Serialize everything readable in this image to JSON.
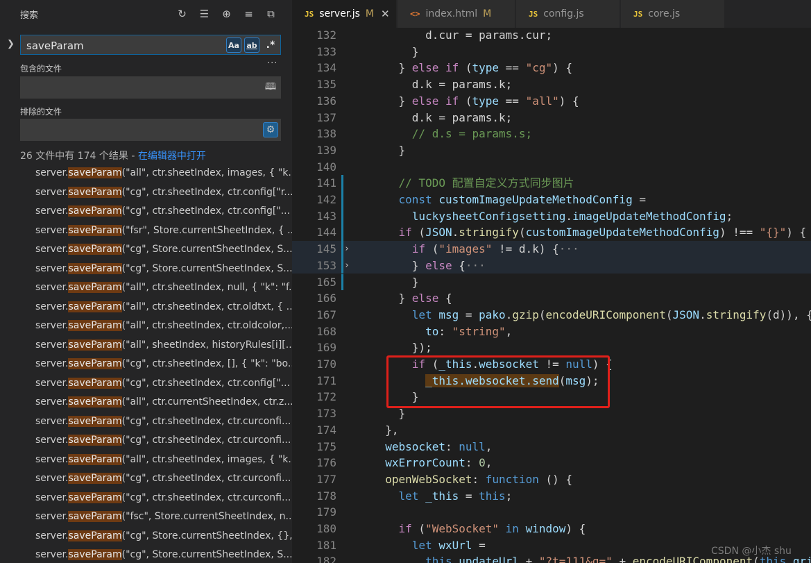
{
  "search_panel": {
    "title": "搜索",
    "toolbar_icons": [
      "refresh-icon",
      "clear-results-icon",
      "new-search-editor-icon",
      "collapse-all-icon",
      "view-as-tree-icon"
    ],
    "query": "saveParam",
    "match_case_label": "Aa",
    "whole_word_label": "ab",
    "regex_label": ".*",
    "more_label": "···",
    "include_label": "包含的文件",
    "include_value": "",
    "exclude_label": "排除的文件",
    "exclude_value": "",
    "summary_text": "26 文件中有 174 个结果 - ",
    "summary_link": "在编辑器中打开",
    "results": [
      {
        "pre": "server.",
        "match": "saveParam",
        "post": "(\"all\", ctr.sheetIndex, images, { \"k..."
      },
      {
        "pre": "server.",
        "match": "saveParam",
        "post": "(\"cg\", ctr.sheetIndex, ctr.config[\"r..."
      },
      {
        "pre": "server.",
        "match": "saveParam",
        "post": "(\"cg\", ctr.sheetIndex, ctr.config[\"..."
      },
      {
        "pre": "server.",
        "match": "saveParam",
        "post": "(\"fsr\", Store.currentSheetIndex, { ..."
      },
      {
        "pre": "server.",
        "match": "saveParam",
        "post": "(\"cg\", Store.currentSheetIndex, S..."
      },
      {
        "pre": "server.",
        "match": "saveParam",
        "post": "(\"cg\", Store.currentSheetIndex, S..."
      },
      {
        "pre": "server.",
        "match": "saveParam",
        "post": "(\"all\", ctr.sheetIndex, null, { \"k\": \"f..."
      },
      {
        "pre": "server.",
        "match": "saveParam",
        "post": "(\"all\", ctr.sheetIndex, ctr.oldtxt, { ..."
      },
      {
        "pre": "server.",
        "match": "saveParam",
        "post": "(\"all\", ctr.sheetIndex, ctr.oldcolor,..."
      },
      {
        "pre": "server.",
        "match": "saveParam",
        "post": "(\"all\", sheetIndex, historyRules[i][..."
      },
      {
        "pre": "server.",
        "match": "saveParam",
        "post": "(\"cg\", ctr.sheetIndex, [], { \"k\": \"bo..."
      },
      {
        "pre": "server.",
        "match": "saveParam",
        "post": "(\"cg\", ctr.sheetIndex, ctr.config[\"..."
      },
      {
        "pre": "server.",
        "match": "saveParam",
        "post": "(\"all\", ctr.currentSheetIndex, ctr.z..."
      },
      {
        "pre": "server.",
        "match": "saveParam",
        "post": "(\"cg\", ctr.sheetIndex, ctr.curconfi..."
      },
      {
        "pre": "server.",
        "match": "saveParam",
        "post": "(\"cg\", ctr.sheetIndex, ctr.curconfi..."
      },
      {
        "pre": "server.",
        "match": "saveParam",
        "post": "(\"all\", ctr.sheetIndex, images, { \"k..."
      },
      {
        "pre": "server.",
        "match": "saveParam",
        "post": "(\"cg\", ctr.sheetIndex, ctr.curconfi..."
      },
      {
        "pre": "server.",
        "match": "saveParam",
        "post": "(\"cg\", ctr.sheetIndex, ctr.curconfi..."
      },
      {
        "pre": "server.",
        "match": "saveParam",
        "post": "(\"fsc\", Store.currentSheetIndex, n..."
      },
      {
        "pre": "server.",
        "match": "saveParam",
        "post": "(\"cg\", Store.currentSheetIndex, {},..."
      },
      {
        "pre": "server.",
        "match": "saveParam",
        "post": "(\"cg\", Store.currentSheetIndex, S..."
      }
    ]
  },
  "tabs": [
    {
      "icon": "JS",
      "label": "server.js",
      "mod": "M",
      "close": "✕",
      "active": true
    },
    {
      "icon": "<>",
      "label": "index.html",
      "mod": "M",
      "close": "",
      "active": false
    },
    {
      "icon": "JS",
      "label": "config.js",
      "mod": "",
      "close": "",
      "active": false
    },
    {
      "icon": "JS",
      "label": "core.js",
      "mod": "",
      "close": "",
      "active": false
    }
  ],
  "editor": {
    "lines": [
      {
        "n": "132",
        "code": [
          [
            "p",
            "        d.cur = params.cur;"
          ]
        ]
      },
      {
        "n": "133",
        "code": [
          [
            "p",
            "      }"
          ]
        ]
      },
      {
        "n": "134",
        "code": [
          [
            "p",
            "    } "
          ],
          [
            "c",
            "else"
          ],
          [
            "p",
            " "
          ],
          [
            "c",
            "if"
          ],
          [
            "p",
            " ("
          ],
          [
            "v",
            "type"
          ],
          [
            "p",
            " == "
          ],
          [
            "s",
            "\"cg\""
          ],
          [
            "p",
            ") {"
          ]
        ]
      },
      {
        "n": "135",
        "code": [
          [
            "p",
            "      d.k = params.k;"
          ]
        ]
      },
      {
        "n": "136",
        "code": [
          [
            "p",
            "    } "
          ],
          [
            "c",
            "else"
          ],
          [
            "p",
            " "
          ],
          [
            "c",
            "if"
          ],
          [
            "p",
            " ("
          ],
          [
            "v",
            "type"
          ],
          [
            "p",
            " == "
          ],
          [
            "s",
            "\"all\""
          ],
          [
            "p",
            ") {"
          ]
        ]
      },
      {
        "n": "137",
        "code": [
          [
            "p",
            "      d.k = params.k;"
          ]
        ]
      },
      {
        "n": "138",
        "code": [
          [
            "cm",
            "      // d.s = params.s;"
          ]
        ]
      },
      {
        "n": "139",
        "code": [
          [
            "p",
            "    }"
          ]
        ]
      },
      {
        "n": "140",
        "code": []
      },
      {
        "n": "141",
        "code": [
          [
            "cm",
            "    // TODO 配置自定义方式同步图片"
          ]
        ]
      },
      {
        "n": "142",
        "code": [
          [
            "k",
            "    const"
          ],
          [
            "p",
            " "
          ],
          [
            "v",
            "customImageUpdateMethodConfig"
          ],
          [
            "p",
            " ="
          ]
        ]
      },
      {
        "n": "143",
        "code": [
          [
            "p",
            "      "
          ],
          [
            "v",
            "luckysheetConfigsetting"
          ],
          [
            "p",
            "."
          ],
          [
            "v",
            "imageUpdateMethodConfig"
          ],
          [
            "p",
            ";"
          ]
        ]
      },
      {
        "n": "144",
        "code": [
          [
            "p",
            "    "
          ],
          [
            "c",
            "if"
          ],
          [
            "p",
            " ("
          ],
          [
            "v",
            "JSON"
          ],
          [
            "p",
            "."
          ],
          [
            "f",
            "stringify"
          ],
          [
            "p",
            "("
          ],
          [
            "v",
            "customImageUpdateMethodConfig"
          ],
          [
            "p",
            ") !== "
          ],
          [
            "s",
            "\"{}\""
          ],
          [
            "p",
            ") {"
          ]
        ]
      },
      {
        "n": "145",
        "fold": "›",
        "folded": true,
        "code": [
          [
            "p",
            "      "
          ],
          [
            "c",
            "if"
          ],
          [
            "p",
            " ("
          ],
          [
            "s",
            "\"images\""
          ],
          [
            "p",
            " != d.k) {"
          ],
          [
            "ellip",
            "···"
          ]
        ]
      },
      {
        "n": "153",
        "fold": "›",
        "folded": true,
        "code": [
          [
            "p",
            "      } "
          ],
          [
            "c",
            "else"
          ],
          [
            "p",
            " {"
          ],
          [
            "ellip",
            "···"
          ]
        ]
      },
      {
        "n": "165",
        "code": [
          [
            "p",
            "      }"
          ]
        ]
      },
      {
        "n": "166",
        "code": [
          [
            "p",
            "    } "
          ],
          [
            "c",
            "else"
          ],
          [
            "p",
            " {"
          ]
        ]
      },
      {
        "n": "167",
        "code": [
          [
            "p",
            "      "
          ],
          [
            "k",
            "let"
          ],
          [
            "p",
            " "
          ],
          [
            "v",
            "msg"
          ],
          [
            "p",
            " = "
          ],
          [
            "v",
            "pako"
          ],
          [
            "p",
            "."
          ],
          [
            "f",
            "gzip"
          ],
          [
            "p",
            "("
          ],
          [
            "f",
            "encodeURIComponent"
          ],
          [
            "p",
            "("
          ],
          [
            "v",
            "JSON"
          ],
          [
            "p",
            "."
          ],
          [
            "f",
            "stringify"
          ],
          [
            "p",
            "(d)), {"
          ]
        ]
      },
      {
        "n": "168",
        "code": [
          [
            "p",
            "        "
          ],
          [
            "v",
            "to"
          ],
          [
            "p",
            ": "
          ],
          [
            "s",
            "\"string\""
          ],
          [
            "p",
            ","
          ]
        ]
      },
      {
        "n": "169",
        "code": [
          [
            "p",
            "      });"
          ]
        ]
      },
      {
        "n": "170",
        "code": [
          [
            "p",
            "      "
          ],
          [
            "c",
            "if"
          ],
          [
            "p",
            " ("
          ],
          [
            "v",
            "_this"
          ],
          [
            "p",
            "."
          ],
          [
            "v",
            "websocket"
          ],
          [
            "p",
            " != "
          ],
          [
            "k",
            "null"
          ],
          [
            "p",
            ") {"
          ]
        ]
      },
      {
        "n": "171",
        "code": [
          [
            "p",
            "        "
          ],
          [
            "hl",
            "_this.websocket.send"
          ],
          [
            "p",
            "("
          ],
          [
            "v",
            "msg"
          ],
          [
            "p",
            ");"
          ]
        ]
      },
      {
        "n": "172",
        "code": [
          [
            "p",
            "      }"
          ]
        ]
      },
      {
        "n": "173",
        "code": [
          [
            "p",
            "    }"
          ]
        ]
      },
      {
        "n": "174",
        "code": [
          [
            "p",
            "  },"
          ]
        ]
      },
      {
        "n": "175",
        "code": [
          [
            "p",
            "  "
          ],
          [
            "v",
            "websocket"
          ],
          [
            "p",
            ": "
          ],
          [
            "k",
            "null"
          ],
          [
            "p",
            ","
          ]
        ]
      },
      {
        "n": "176",
        "code": [
          [
            "p",
            "  "
          ],
          [
            "v",
            "wxErrorCount"
          ],
          [
            "p",
            ": "
          ],
          [
            "n",
            "0"
          ],
          [
            "p",
            ","
          ]
        ]
      },
      {
        "n": "177",
        "code": [
          [
            "p",
            "  "
          ],
          [
            "f",
            "openWebSocket"
          ],
          [
            "p",
            ": "
          ],
          [
            "k",
            "function"
          ],
          [
            "p",
            " () {"
          ]
        ]
      },
      {
        "n": "178",
        "code": [
          [
            "p",
            "    "
          ],
          [
            "k",
            "let"
          ],
          [
            "p",
            " "
          ],
          [
            "v",
            "_this"
          ],
          [
            "p",
            " = "
          ],
          [
            "k",
            "this"
          ],
          [
            "p",
            ";"
          ]
        ]
      },
      {
        "n": "179",
        "code": []
      },
      {
        "n": "180",
        "code": [
          [
            "p",
            "    "
          ],
          [
            "c",
            "if"
          ],
          [
            "p",
            " ("
          ],
          [
            "s",
            "\"WebSocket\""
          ],
          [
            "p",
            " "
          ],
          [
            "k",
            "in"
          ],
          [
            "p",
            " "
          ],
          [
            "v",
            "window"
          ],
          [
            "p",
            ") {"
          ]
        ]
      },
      {
        "n": "181",
        "code": [
          [
            "p",
            "      "
          ],
          [
            "k",
            "let"
          ],
          [
            "p",
            " "
          ],
          [
            "v",
            "wxUrl"
          ],
          [
            "p",
            " ="
          ]
        ]
      },
      {
        "n": "182",
        "code": [
          [
            "p",
            "        "
          ],
          [
            "k",
            "this"
          ],
          [
            "p",
            "."
          ],
          [
            "v",
            "updateUrl"
          ],
          [
            "p",
            " + "
          ],
          [
            "s",
            "\"?t=111&g=\""
          ],
          [
            "p",
            " + "
          ],
          [
            "f",
            "encodeURIComponent"
          ],
          [
            "p",
            "("
          ],
          [
            "k",
            "this"
          ],
          [
            "p",
            "."
          ],
          [
            "v",
            "gri"
          ]
        ]
      }
    ]
  },
  "watermark": "CSDN @小杰 shu"
}
